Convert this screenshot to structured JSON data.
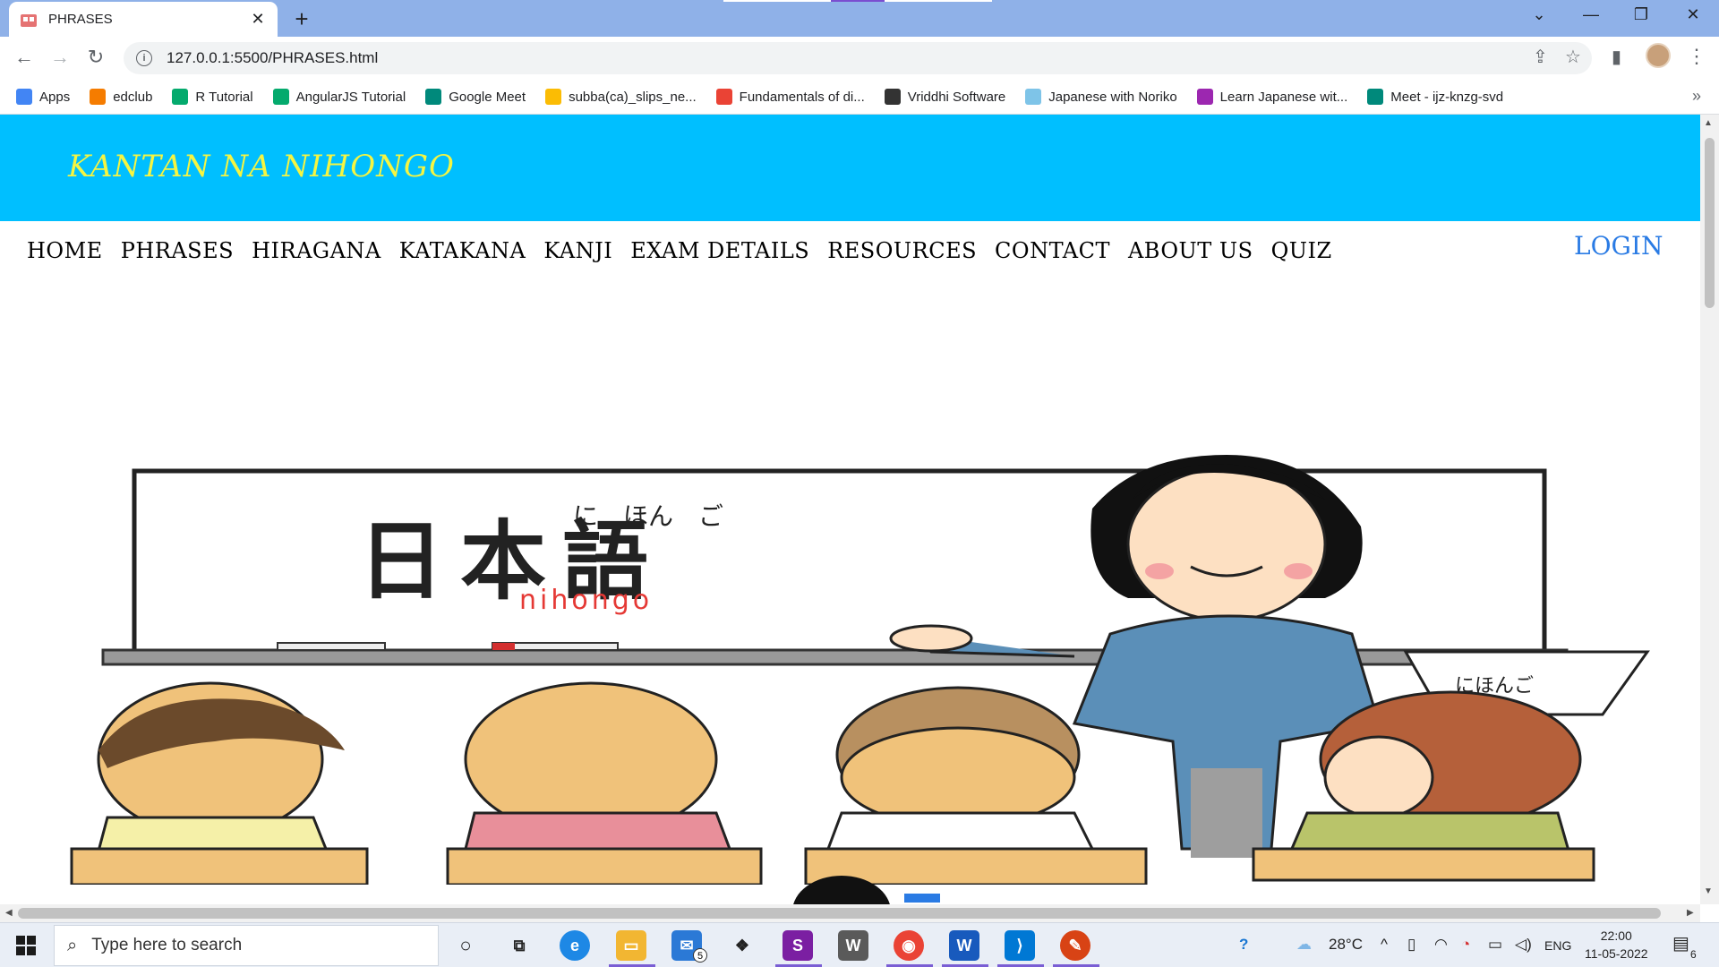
{
  "browser": {
    "tab_title": "PHRASES",
    "url": "127.0.0.1:5500/PHRASES.html",
    "bookmarks": [
      {
        "label": "Apps",
        "icon": "apps-grid-icon",
        "color": "#4285f4"
      },
      {
        "label": "edclub",
        "icon": "edclub-icon",
        "color": "#f57c00"
      },
      {
        "label": "R Tutorial",
        "icon": "w3schools-icon",
        "color": "#04aa6d"
      },
      {
        "label": "AngularJS Tutorial",
        "icon": "w3schools-icon",
        "color": "#04aa6d"
      },
      {
        "label": "Google Meet",
        "icon": "google-meet-icon",
        "color": "#00897b"
      },
      {
        "label": "subba(ca)_slips_ne...",
        "icon": "google-drive-icon",
        "color": "#fbbc04"
      },
      {
        "label": "Fundamentals of di...",
        "icon": "google-icon",
        "color": "#ea4335"
      },
      {
        "label": "Vriddhi Software",
        "icon": "globe-icon",
        "color": "#333333"
      },
      {
        "label": "Japanese with Noriko",
        "icon": "noriko-icon",
        "color": "#7ec4e8"
      },
      {
        "label": "Learn Japanese wit...",
        "icon": "podcast-icon",
        "color": "#9c27b0"
      },
      {
        "label": "Meet - ijz-knzg-svd",
        "icon": "google-meet-icon",
        "color": "#00897b"
      }
    ]
  },
  "site": {
    "logo": "KANTAN NA NIHONGO",
    "nav": [
      "HOME",
      "PHRASES",
      "HIRAGANA",
      "KATAKANA",
      "KANJI",
      "EXAM DETAILS",
      "RESOURCES",
      "CONTACT",
      "ABOUT US",
      "QUIZ"
    ],
    "login": "LOGIN",
    "header_color": "#00bfff",
    "logo_color": "#f5f542",
    "login_color": "#2a7be4"
  },
  "illustration": {
    "furigana": "に　ほん　ご",
    "kanji": "日本語",
    "romaji": "nihongo",
    "book_text": "にほんご"
  },
  "taskbar": {
    "search_placeholder": "Type here to search",
    "mail_badge": "5",
    "weather": "28°C",
    "language": "ENG",
    "time": "22:00",
    "date": "11-05-2022",
    "notification_count": "6"
  }
}
